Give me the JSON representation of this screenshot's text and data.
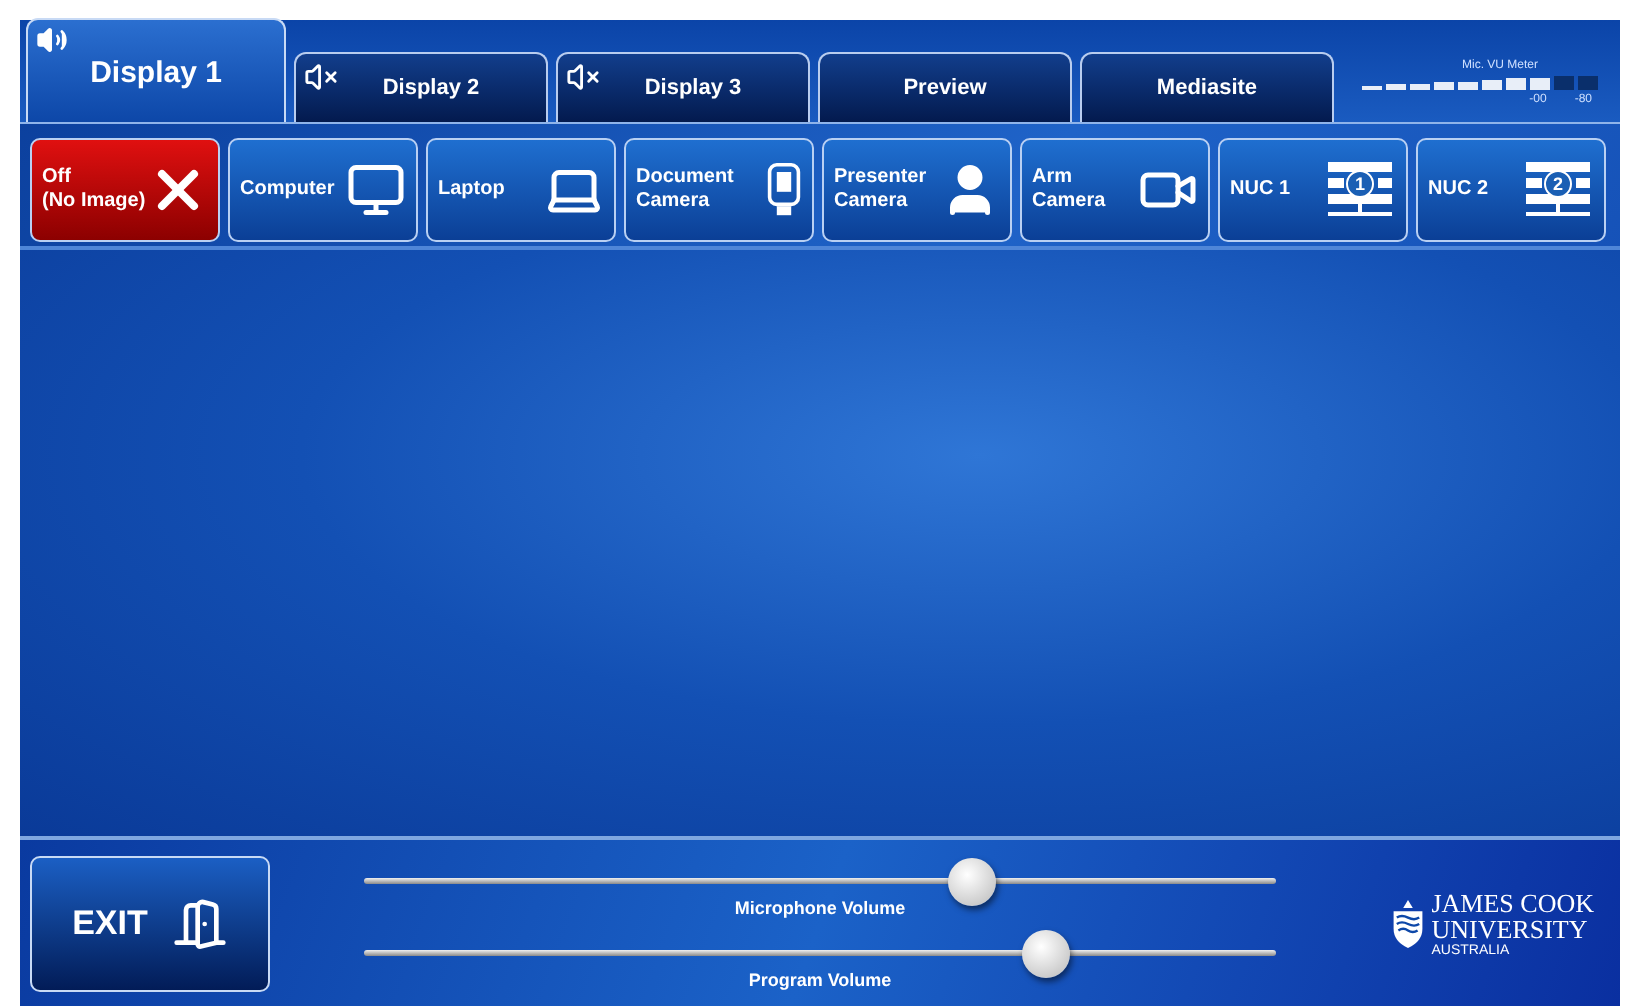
{
  "tabs": [
    {
      "label": "Display 1",
      "selected": true,
      "muted": false
    },
    {
      "label": "Display 2",
      "selected": false,
      "muted": true
    },
    {
      "label": "Display 3",
      "selected": false,
      "muted": true
    },
    {
      "label": "Preview",
      "selected": false
    },
    {
      "label": "Mediasite",
      "selected": false
    }
  ],
  "vu_meter": {
    "title": "Mic. VU Meter",
    "level": 0.8,
    "ticks": [
      "-00",
      "-80"
    ]
  },
  "sources": [
    {
      "label": "Off\n(No Image)",
      "kind": "off",
      "selected": true
    },
    {
      "label": "Computer",
      "kind": "computer",
      "selected": false
    },
    {
      "label": "Laptop",
      "kind": "laptop",
      "selected": false
    },
    {
      "label": "Document\nCamera",
      "kind": "document-camera",
      "selected": false
    },
    {
      "label": "Presenter\nCamera",
      "kind": "presenter",
      "selected": false
    },
    {
      "label": "Arm\nCamera",
      "kind": "camera",
      "selected": false
    },
    {
      "label": "NUC 1",
      "kind": "nuc",
      "number": "1",
      "selected": false
    },
    {
      "label": "NUC 2",
      "kind": "nuc",
      "number": "2",
      "selected": false
    }
  ],
  "exit_button": {
    "label": "EXIT"
  },
  "sliders": [
    {
      "label": "Microphone Volume",
      "level": 0.667
    },
    {
      "label": "Program Volume",
      "level": 0.748
    }
  ],
  "logo": {
    "line_1": "JAMES COOK",
    "line_2": "UNIVERSITY",
    "line_3": "AUSTRALIA"
  }
}
